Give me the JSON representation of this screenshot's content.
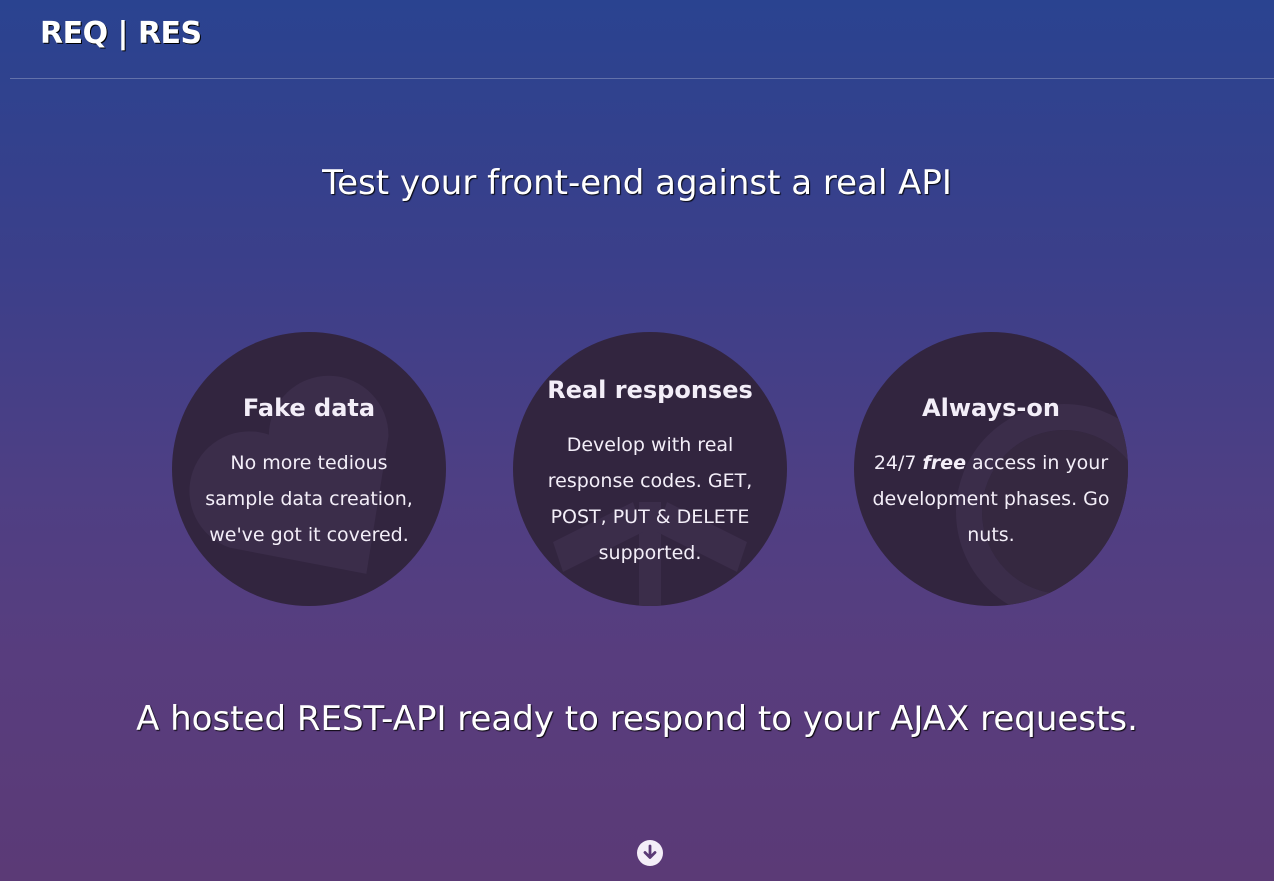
{
  "header": {
    "logo": "REQ | RES"
  },
  "hero": {
    "tagline": "Test your front-end against a real API",
    "headline": "A hosted REST-API ready to respond to your AJAX requests."
  },
  "features": [
    {
      "title": "Fake data",
      "text": "No more tedious sample data creation, we've got it covered.",
      "icon": "heart-icon"
    },
    {
      "title": "Real responses",
      "text": "Develop with real response codes. GET, POST, PUT & DELETE supported.",
      "icon": "signpost-icon"
    },
    {
      "title": "Always-on",
      "text_prefix": "24/7 ",
      "text_emphasis": "free",
      "text_suffix": " access in your development phases. Go nuts.",
      "icon": "power-icon"
    }
  ],
  "scroll": {
    "icon": "arrow-down-circle-icon"
  },
  "colors": {
    "circle_bg": "#32253f",
    "gradient_top": "#2a4390",
    "gradient_bottom": "#5b3a76"
  }
}
